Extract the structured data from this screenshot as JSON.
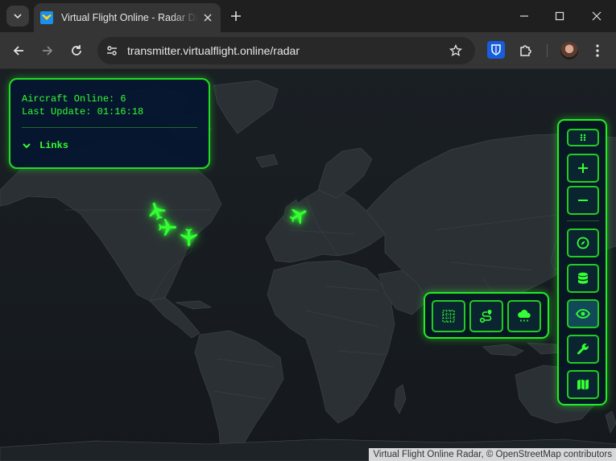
{
  "browser": {
    "tab_title": "Virtual Flight Online - Radar Display",
    "url": "transmitter.virtualflight.online/radar"
  },
  "info_panel": {
    "aircraft_online": "Aircraft Online: 6",
    "last_update": "Last Update: 01:16:18",
    "links_label": "Links"
  },
  "aircraft": [
    {
      "name": "aircraft-marker-1",
      "icon": "airplane-icon"
    },
    {
      "name": "aircraft-marker-2",
      "icon": "airplane-icon"
    },
    {
      "name": "aircraft-marker-3",
      "icon": "airplane-icon"
    },
    {
      "name": "aircraft-marker-4",
      "icon": "airplane-icon"
    }
  ],
  "layer_panel": {
    "buttons": [
      "grid-layer-icon",
      "route-icon",
      "weather-rain-icon"
    ]
  },
  "control_rail": {
    "buttons": [
      "drag-handle-icon",
      "zoom-in-icon",
      "zoom-out-icon",
      "compass-icon",
      "database-icon",
      "eye-icon",
      "wrench-icon",
      "map-icon"
    ],
    "active": "eye-icon"
  },
  "attribution": "Virtual Flight Online Radar, © OpenStreetMap contributors",
  "colors": {
    "accent_green": "#22ee22",
    "panel_bg": "#041630",
    "map_ocean": "#1a1f24",
    "map_land": "#2b3035"
  }
}
